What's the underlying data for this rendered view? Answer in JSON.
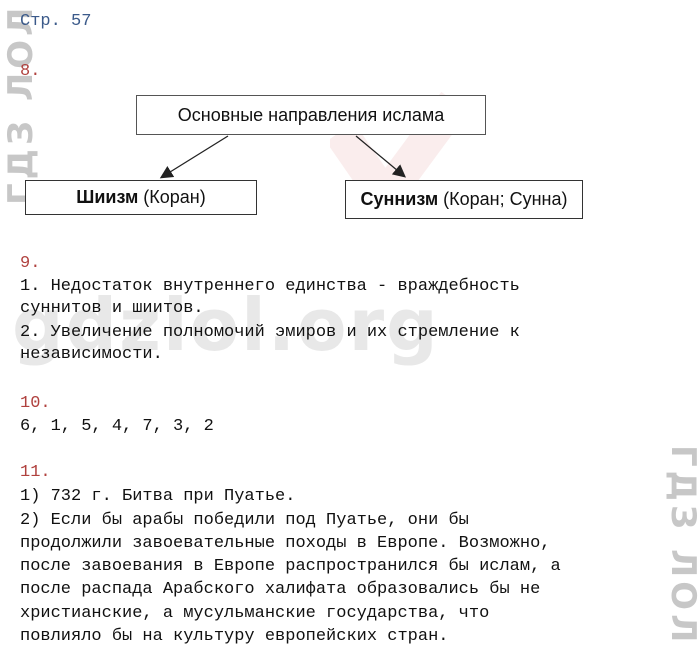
{
  "page_ref": "Стр. 57",
  "watermark_main": "gdzlol.org",
  "watermark_side": "ГДЗ ЛОЛ",
  "task8": {
    "number": "8.",
    "diagram": {
      "root": "Основные направления ислама",
      "left_bold": "Шиизм",
      "left_rest": "(Коран)",
      "right_bold": "Суннизм",
      "right_rest": "(Коран; Сунна)"
    }
  },
  "task9": {
    "number": "9.",
    "lines": [
      "1. Недостаток внутреннего единства - враждебность",
      "суннитов и шиитов.",
      "2. Увеличение полномочий эмиров и их стремление к",
      "независимости."
    ]
  },
  "task10": {
    "number": "10.",
    "answer": "6, 1, 5, 4, 7, 3, 2"
  },
  "task11": {
    "number": "11.",
    "lines": [
      "1) 732 г. Битва при Пуатье.",
      "2) Если бы арабы победили под Пуатье, они бы",
      "продолжили завоевательные походы в Европе. Возможно,",
      "после завоевания в Европе распространился бы ислам, а",
      "после распада Арабского халифата образовались бы не",
      "христианские, а мусульманские государства, что",
      "повлияло бы на культуру европейских стран."
    ]
  }
}
